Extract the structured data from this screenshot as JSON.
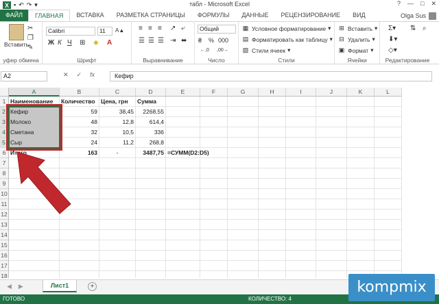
{
  "window": {
    "title": "табл - Microsoft Excel",
    "controls": [
      "?",
      "—",
      "□",
      "✕"
    ]
  },
  "tabs": [
    "ФАЙЛ",
    "ГЛАВНАЯ",
    "ВСТАВКА",
    "РАЗМЕТКА СТРАНИЦЫ",
    "ФОРМУЛЫ",
    "ДАННЫЕ",
    "РЕЦЕНЗИРОВАНИЕ",
    "ВИД"
  ],
  "active_tab": "ГЛАВНАЯ",
  "user": "Olga Sus",
  "ribbon": {
    "paste_label": "Вставить",
    "clipboard_label": "уфер обмена",
    "font_name": "Calibri",
    "font_size": "11",
    "font_label": "Шрифт",
    "bold": "Ж",
    "italic": "К",
    "underline": "Ч",
    "align_label": "Выравнивание",
    "number_format": "Общий",
    "number_label": "Число",
    "cond_format": "Условное форматирование",
    "format_table": "Форматировать как таблицу",
    "cell_styles": "Стили ячеек",
    "styles_label": "Стили",
    "insert": "Вставить",
    "delete": "Удалить",
    "format": "Формат",
    "cells_label": "Ячейки",
    "editing_label": "Редактирование"
  },
  "formula_bar": {
    "name_box": "A2",
    "fx": "fx",
    "content": "Кефир"
  },
  "columns": [
    "A",
    "B",
    "C",
    "D",
    "E",
    "F",
    "G",
    "H",
    "I",
    "J",
    "K",
    "L"
  ],
  "rows": [
    "1",
    "2",
    "3",
    "4",
    "5",
    "6",
    "7",
    "8",
    "9",
    "10",
    "11",
    "12",
    "13",
    "14",
    "15",
    "16",
    "17",
    "18"
  ],
  "table": {
    "headers": [
      "Наименование",
      "Количество",
      "Цена, грн",
      "Сумма"
    ],
    "data": [
      [
        "Кефир",
        "59",
        "38,45",
        "2268,55"
      ],
      [
        "Молоко",
        "48",
        "12,8",
        "614,4"
      ],
      [
        "Сметана",
        "32",
        "10,5",
        "336"
      ],
      [
        "Сыр",
        "24",
        "11,2",
        "268,8"
      ]
    ],
    "total": [
      "Итого",
      "163",
      "-",
      "3487,75",
      "=СУММ(D2:D5)"
    ]
  },
  "sheet_tab": "Лист1",
  "status": {
    "ready": "ГОТОВО",
    "count": "КОЛИЧЕСТВО: 4"
  },
  "watermark": "kompmix",
  "colors": {
    "accent": "#217346",
    "annotation": "#c0282d",
    "selection_fill": "#c6c6c6"
  }
}
